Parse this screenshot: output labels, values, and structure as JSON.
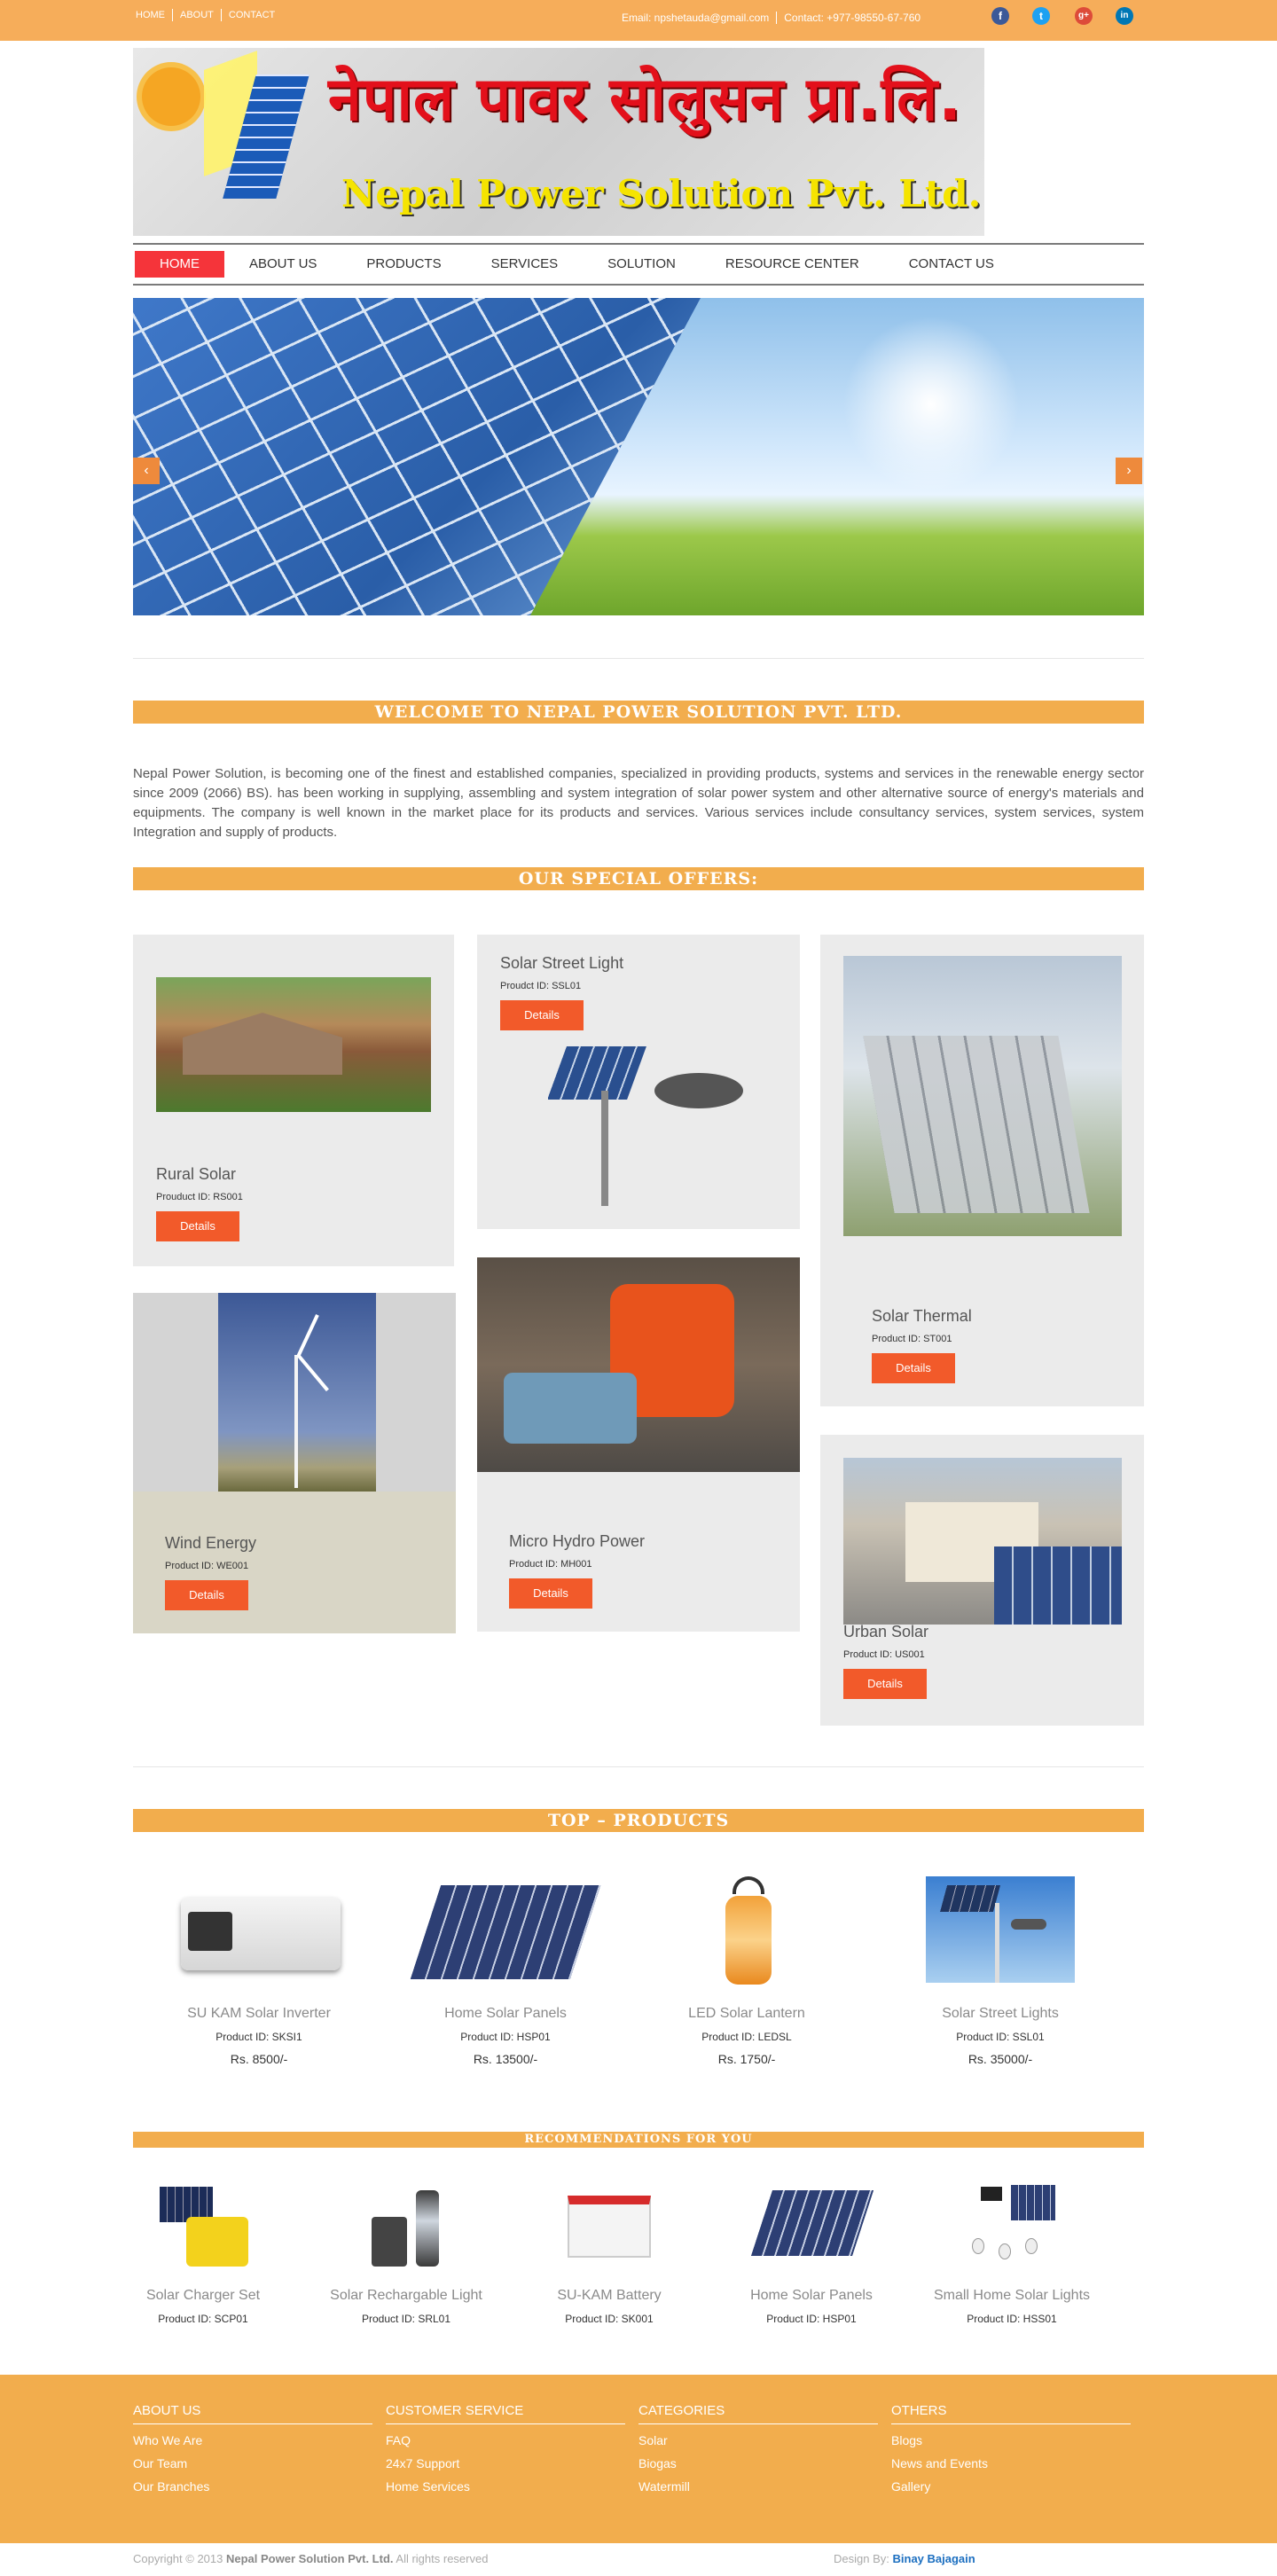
{
  "topbar": {
    "links": [
      "HOME",
      "ABOUT",
      "CONTACT"
    ],
    "email": "Email: npshetauda@gmail.com",
    "contact": "Contact: +977-98550-67-760",
    "social": [
      "f",
      "t",
      "g+",
      "in"
    ]
  },
  "logo": {
    "nepali": "नेपाल पावर सोलुसन प्रा.लि.",
    "english": "Nepal Power Solution Pvt. Ltd."
  },
  "nav": {
    "items": [
      "HOME",
      "ABOUT US",
      "PRODUCTS",
      "SERVICES",
      "SOLUTION",
      "RESOURCE CENTER",
      "CONTACT US"
    ],
    "active": "HOME"
  },
  "slider": {
    "prev": "‹",
    "next": "›"
  },
  "welcome": {
    "heading": "WELCOME TO NEPAL POWER SOLUTION PVT. LTD.",
    "text": "Nepal Power Solution, is becoming one of the finest and established companies, specialized in providing products, systems and services in the renewable energy sector since 2009 (2066) BS). has been working in supplying, assembling and system integration of solar power system and other alternative source of energy's materials and equipments. The company is well known in the market place for its products and services. Various services include consultancy services, system services, system Integration and supply of products."
  },
  "offers": {
    "heading": "OUR SPECIAL OFFERS:",
    "button_label": "Details",
    "items": [
      {
        "title": "Rural Solar",
        "id": "Prouduct ID: RS001"
      },
      {
        "title": "Solar Street Light",
        "id": "Proudct ID: SSL01"
      },
      {
        "title": "Solar Thermal",
        "id": "Product ID: ST001"
      },
      {
        "title": "Wind Energy",
        "id": "Product ID: WE001"
      },
      {
        "title": "Micro Hydro Power",
        "id": "Product ID: MH001"
      },
      {
        "title": "Urban Solar",
        "id": "Product ID: US001"
      }
    ]
  },
  "top_products": {
    "heading": "TOP – PRODUCTS",
    "items": [
      {
        "name": "SU KAM Solar Inverter",
        "id": "Product ID: SKSI1",
        "price": "Rs. 8500/-"
      },
      {
        "name": "Home Solar Panels",
        "id": "Product ID: HSP01",
        "price": "Rs. 13500/-"
      },
      {
        "name": "LED Solar Lantern",
        "id": "Product ID: LEDSL",
        "price": "Rs. 1750/-"
      },
      {
        "name": "Solar Street Lights",
        "id": "Product ID: SSL01",
        "price": "Rs. 35000/-"
      }
    ]
  },
  "recommendations": {
    "heading": "RECOMMENDATIONS FOR YOU",
    "items": [
      {
        "name": "Solar Charger Set",
        "id": "Product ID: SCP01"
      },
      {
        "name": "Solar Rechargable Light",
        "id": "Product ID: SRL01"
      },
      {
        "name": "SU-KAM Battery",
        "id": "Product ID: SK001"
      },
      {
        "name": "Home Solar Panels",
        "id": "Product ID: HSP01"
      },
      {
        "name": "Small Home Solar Lights",
        "id": "Product ID: HSS01"
      }
    ]
  },
  "footer": {
    "columns": [
      {
        "heading": "ABOUT US",
        "links": [
          "Who We Are",
          "Our Team",
          "Our Branches"
        ]
      },
      {
        "heading": "CUSTOMER SERVICE",
        "links": [
          "FAQ",
          "24x7 Support",
          "Home Services"
        ]
      },
      {
        "heading": "CATEGORIES",
        "links": [
          "Solar",
          "Biogas",
          "Watermill"
        ]
      },
      {
        "heading": "OTHERS",
        "links": [
          "Blogs",
          "News and Events",
          "Gallery"
        ]
      }
    ],
    "copyright_prefix": "Copyright © 2013",
    "company": "Nepal Power Solution Pvt. Ltd.",
    "rights": "All rights reserved",
    "design_prefix": "Design By:",
    "designer": "Binay Bajagain"
  },
  "colors": {
    "accent": "#f6ad5a",
    "band": "#f2ad4d",
    "button": "#f25a2a",
    "nav_active": "#f5343a"
  }
}
